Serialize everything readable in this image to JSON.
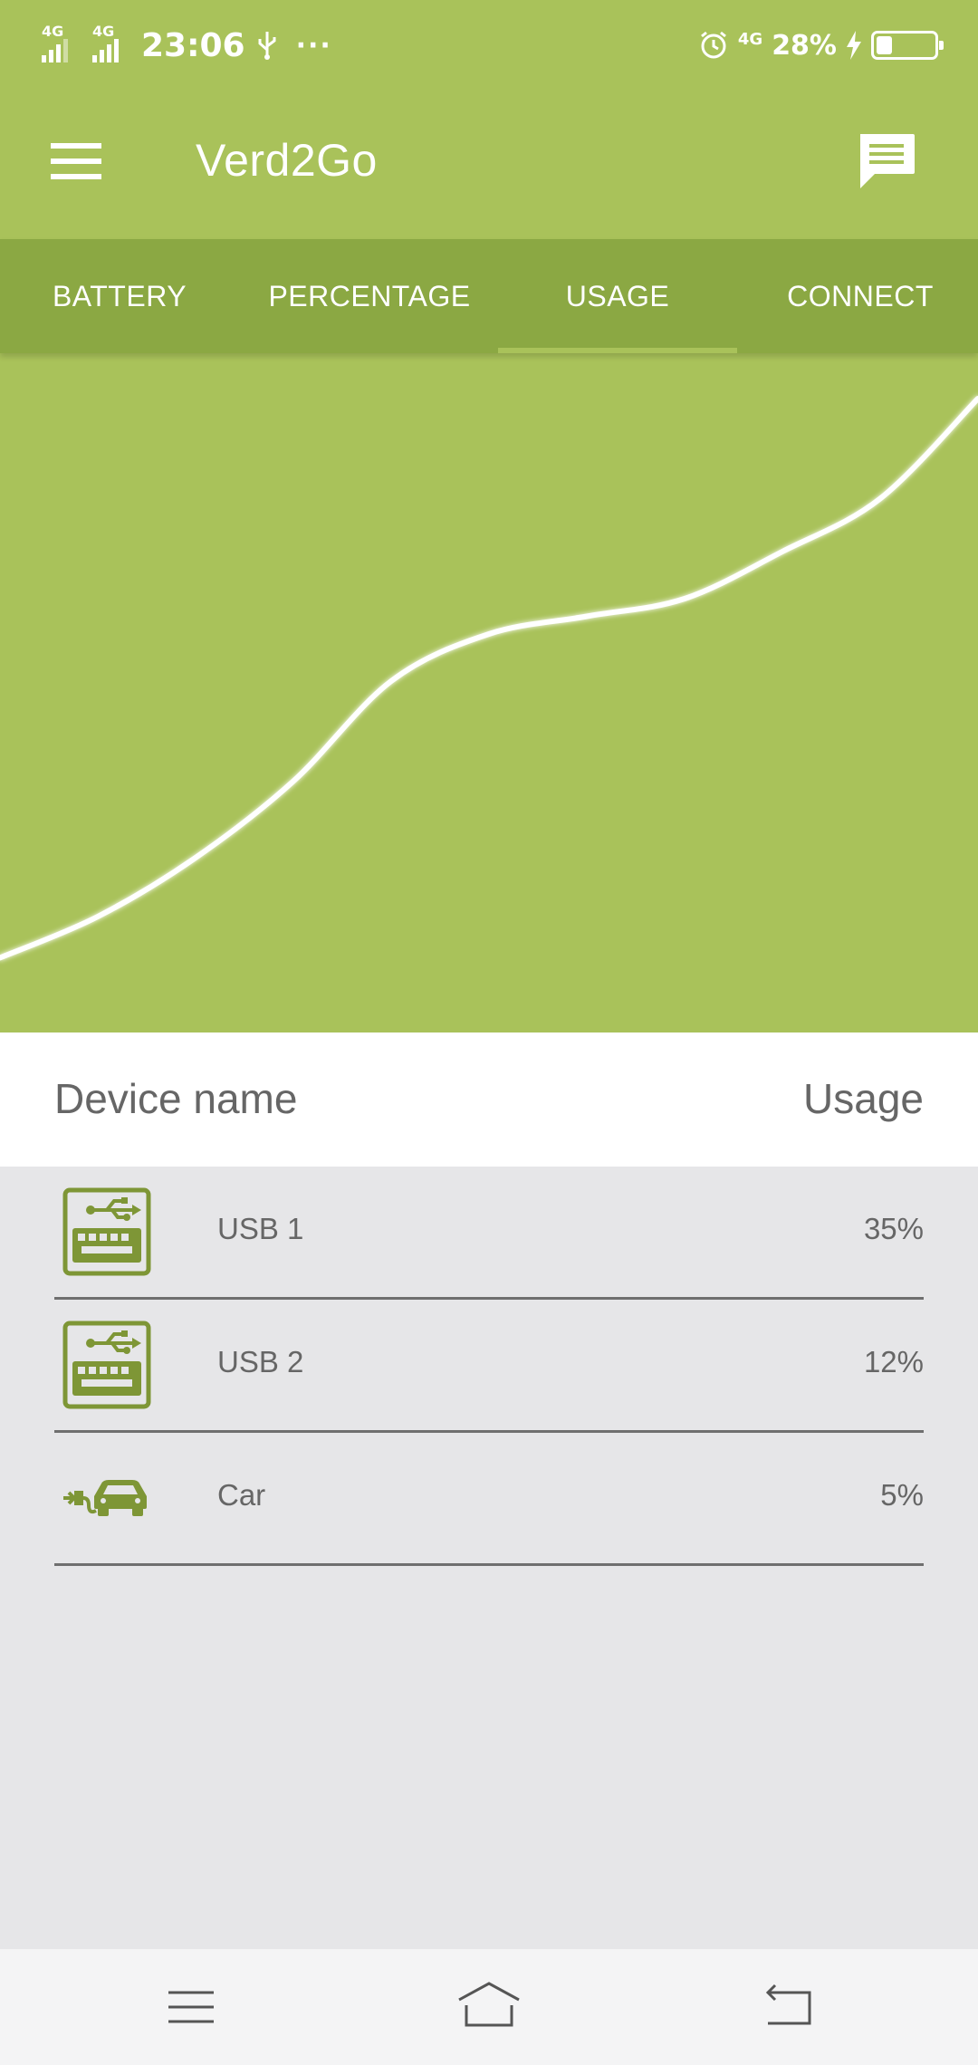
{
  "status_bar": {
    "signal1_label": "4G",
    "signal2_label": "4G",
    "time": "23:06",
    "usb_icon": "usb-icon",
    "more_dots": "···",
    "alarm_icon": "alarm-icon",
    "data_label": "4G",
    "battery_percent": "28%",
    "battery_level": 0.28,
    "charging_icon": "lightning-icon"
  },
  "app_bar": {
    "title": "Verd2Go",
    "menu_icon": "hamburger-menu-icon",
    "action_icon": "chat-icon"
  },
  "tabs": [
    {
      "label": "BATTERY",
      "selected": false
    },
    {
      "label": "PERCENTAGE",
      "selected": false
    },
    {
      "label": "USAGE",
      "selected": true
    },
    {
      "label": "CONNECT",
      "selected": false
    }
  ],
  "colors": {
    "primary": "#a9c25a",
    "primary_dark": "#8ba843",
    "icon": "#7e9636",
    "line": "#ffffff",
    "list_background": "#e6e6e8"
  },
  "chart_data": {
    "type": "line",
    "title": "",
    "xlabel": "",
    "ylabel": "",
    "grid": false,
    "legend": false,
    "x": [
      0,
      1,
      2,
      3,
      4,
      5,
      6,
      7,
      8,
      9,
      10
    ],
    "series": [
      {
        "values": [
          0.05,
          0.12,
          0.22,
          0.35,
          0.52,
          0.6,
          0.63,
          0.66,
          0.74,
          0.83,
          1.0
        ]
      }
    ],
    "xlim": [
      0,
      10
    ],
    "ylim": [
      0,
      1
    ]
  },
  "table": {
    "header_name": "Device name",
    "header_usage": "Usage",
    "rows": [
      {
        "icon": "usb-keyboard-icon",
        "name": "USB 1",
        "value": "35%"
      },
      {
        "icon": "usb-keyboard-icon",
        "name": "USB 2",
        "value": "12%"
      },
      {
        "icon": "electric-car-icon",
        "name": "Car",
        "value": "5%"
      }
    ]
  },
  "nav_bar": {
    "menu_icon": "nav-menu-icon",
    "home_icon": "nav-home-icon",
    "back_icon": "nav-back-icon"
  }
}
